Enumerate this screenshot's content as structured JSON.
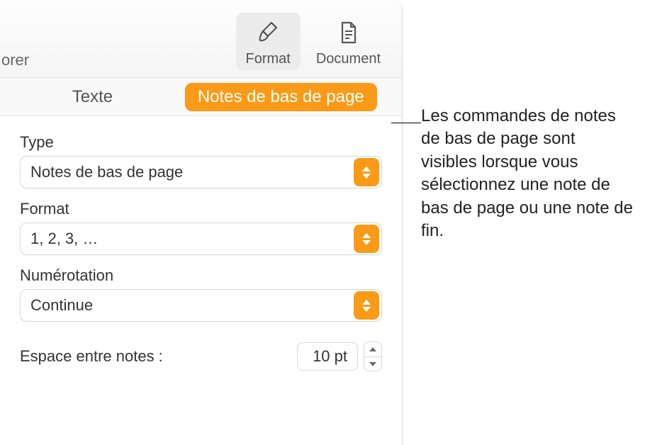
{
  "toolbar": {
    "left_text": "orer",
    "format": {
      "label": "Format"
    },
    "document": {
      "label": "Document"
    }
  },
  "tabs": {
    "text": "Texte",
    "footnotes": "Notes de bas de page"
  },
  "controls": {
    "type": {
      "label": "Type",
      "value": "Notes de bas de page"
    },
    "format": {
      "label": "Format",
      "value": "1, 2, 3, …"
    },
    "numbering": {
      "label": "Numérotation",
      "value": "Continue"
    },
    "spacing": {
      "label": "Espace entre notes :",
      "value": "10 pt"
    }
  },
  "callout": {
    "text": "Les commandes de notes de bas de page sont visibles lorsque vous sélectionnez une note de bas de page ou une note de fin."
  }
}
